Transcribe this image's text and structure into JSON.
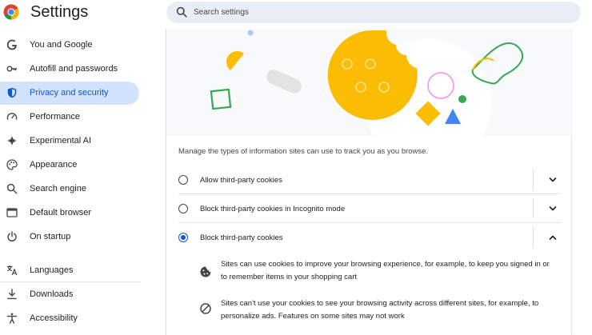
{
  "app": {
    "title": "Settings"
  },
  "search": {
    "placeholder": "Search settings"
  },
  "sidebar": {
    "items": [
      {
        "label": "You and Google",
        "icon": "google-g-icon"
      },
      {
        "label": "Autofill and passwords",
        "icon": "key-icon"
      },
      {
        "label": "Privacy and security",
        "icon": "shield-icon",
        "active": true
      },
      {
        "label": "Performance",
        "icon": "speedometer-icon"
      },
      {
        "label": "Experimental AI",
        "icon": "sparkle-icon"
      },
      {
        "label": "Appearance",
        "icon": "palette-icon"
      },
      {
        "label": "Search engine",
        "icon": "search-icon"
      },
      {
        "label": "Default browser",
        "icon": "browser-window-icon"
      },
      {
        "label": "On startup",
        "icon": "power-icon"
      },
      {
        "label": "Languages",
        "icon": "translate-icon"
      },
      {
        "label": "Downloads",
        "icon": "download-icon"
      },
      {
        "label": "Accessibility",
        "icon": "accessibility-icon"
      }
    ]
  },
  "cookies": {
    "description": "Manage the types of information sites can use to track you as you browse.",
    "options": [
      {
        "label": "Allow third-party cookies",
        "selected": false,
        "expanded": false
      },
      {
        "label": "Block third-party cookies in Incognito mode",
        "selected": false,
        "expanded": false
      },
      {
        "label": "Block third-party cookies",
        "selected": true,
        "expanded": true
      }
    ],
    "details": [
      {
        "icon": "cookie-icon",
        "text": "Sites can use cookies to improve your browsing experience, for example, to keep you signed in or to remember items in your shopping cart"
      },
      {
        "icon": "block-icon",
        "text": "Sites can't use your cookies to see your browsing activity across different sites, for example, to personalize ads. Features on some sites may not work"
      }
    ]
  },
  "colors": {
    "accent": "#0b57d0",
    "active_nav_bg": "#d3e3fd",
    "search_bg": "#e9eef6",
    "illustration_yellow": "#fbbc04",
    "illustration_green": "#34a853",
    "illustration_blue": "#4285f4"
  }
}
